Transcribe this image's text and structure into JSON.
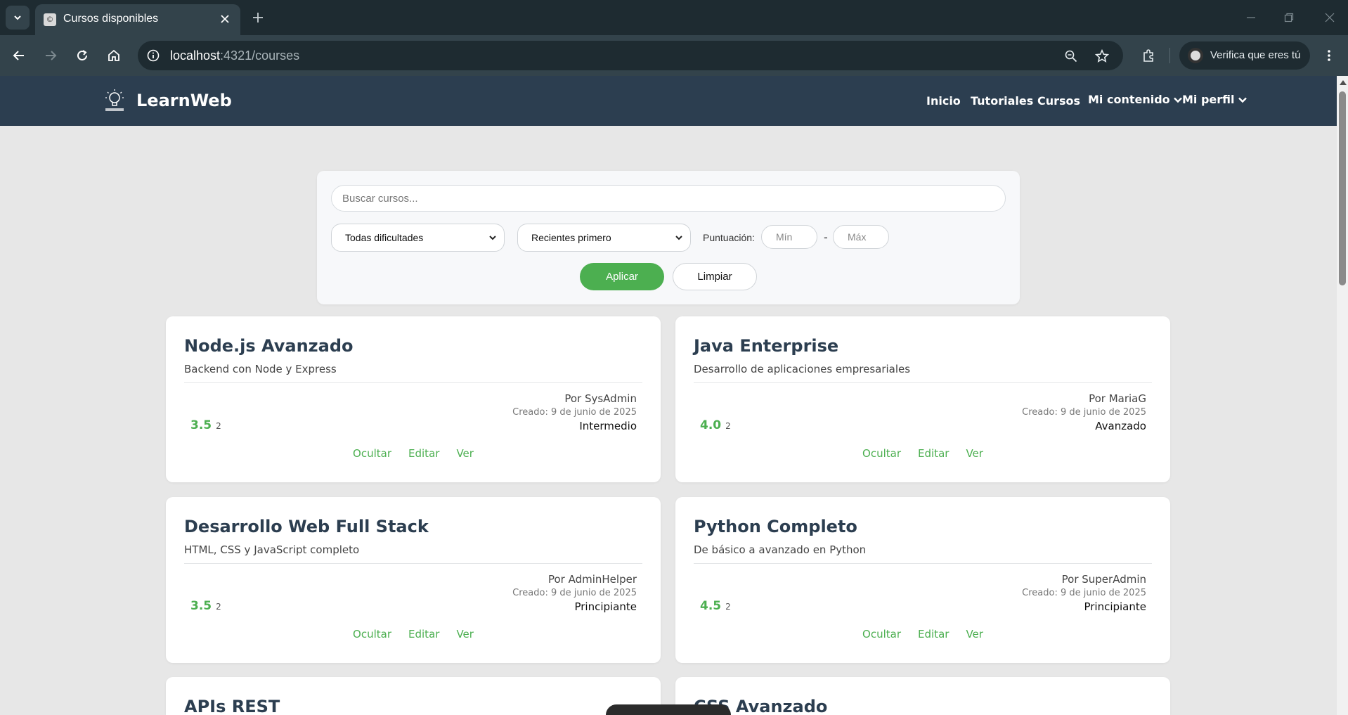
{
  "browser": {
    "tab_title": "Cursos disponibles",
    "url_host": "localhost",
    "url_rest": ":4321/courses",
    "profile_label": "Verifica que eres tú"
  },
  "site": {
    "brand": "LearnWeb",
    "nav": {
      "inicio": "Inicio",
      "tutoriales": "Tutoriales",
      "cursos": "Cursos",
      "mi_contenido": "Mi contenido",
      "mi_perfil": "Mi perfil"
    }
  },
  "filters": {
    "search_placeholder": "Buscar cursos...",
    "difficulty_selected": "Todas dificultades",
    "sort_selected": "Recientes primero",
    "score_label": "Puntuación:",
    "min_placeholder": "Mín",
    "max_placeholder": "Máx",
    "dash": "-",
    "apply_label": "Aplicar",
    "clear_label": "Limpiar"
  },
  "courses": [
    {
      "title": "Node.js Avanzado",
      "description": "Backend con Node y Express",
      "rating": "3.5",
      "rating_count": "2",
      "author": "Por SysAdmin",
      "created": "Creado: 9 de junio de 2025",
      "level": "Intermedio",
      "actions": [
        "Ocultar",
        "Editar",
        "Ver"
      ]
    },
    {
      "title": "Java Enterprise",
      "description": "Desarrollo de aplicaciones empresariales",
      "rating": "4.0",
      "rating_count": "2",
      "author": "Por MariaG",
      "created": "Creado: 9 de junio de 2025",
      "level": "Avanzado",
      "actions": [
        "Ocultar",
        "Editar",
        "Ver"
      ]
    },
    {
      "title": "Desarrollo Web Full Stack",
      "description": "HTML, CSS y JavaScript completo",
      "rating": "3.5",
      "rating_count": "2",
      "author": "Por AdminHelper",
      "created": "Creado: 9 de junio de 2025",
      "level": "Principiante",
      "actions": [
        "Ocultar",
        "Editar",
        "Ver"
      ]
    },
    {
      "title": "Python Completo",
      "description": "De básico a avanzado en Python",
      "rating": "4.5",
      "rating_count": "2",
      "author": "Por SuperAdmin",
      "created": "Creado: 9 de junio de 2025",
      "level": "Principiante",
      "actions": [
        "Ocultar",
        "Editar",
        "Ver"
      ]
    },
    {
      "title": "APIs REST"
    },
    {
      "title": "CSS Avanzado"
    }
  ],
  "colors": {
    "header_bg": "#2c3e50",
    "accent_green": "#4caf50",
    "page_bg": "#e7e7e7",
    "title_color": "#2c3e50"
  }
}
